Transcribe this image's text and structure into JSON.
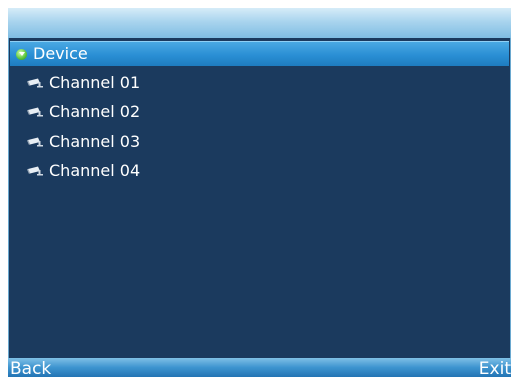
{
  "tree": {
    "root": {
      "label": "Device",
      "icon": "expand-icon",
      "expanded": true,
      "selected": true
    },
    "channels": [
      {
        "label": "Channel 01",
        "icon": "camera-icon"
      },
      {
        "label": "Channel 02",
        "icon": "camera-icon"
      },
      {
        "label": "Channel 03",
        "icon": "camera-icon"
      },
      {
        "label": "Channel 04",
        "icon": "camera-icon"
      }
    ]
  },
  "softkeys": {
    "left_label": "Back",
    "right_label": "Exit"
  },
  "colors": {
    "panel_background": "#1b3a5e",
    "selection": "#2a8fd4",
    "text": "#ffffff"
  }
}
